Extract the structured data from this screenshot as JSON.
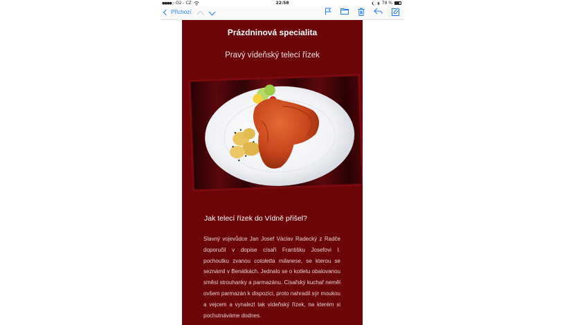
{
  "status_bar": {
    "carrier": "O2 - CZ",
    "time": "22:58",
    "battery": "79 %"
  },
  "toolbar": {
    "back_label": "Příchozí",
    "icons": [
      "chevron-up-icon",
      "chevron-down-icon",
      "flag-icon",
      "folder-icon",
      "trash-icon",
      "reply-icon",
      "compose-icon"
    ]
  },
  "email": {
    "title": "Prázdninová specialita",
    "subtitle": "Pravý vídeňský telecí řízek",
    "photo_alt": "plate with breaded schnitzel, potatoes and salad",
    "section_heading": "Jak telecí řízek do Vídně přišel?",
    "paragraph": {
      "part1": "Slavný vojevůdce Jan Josef Václav Radecký z Radče doporučil v dopise císaři Františku Josefovi I. pochoutku zvanou ",
      "italic": "cotoletta milanese",
      "part2": ", se kterou se seznámil v Benátkách. Jednalo se o kotletu obalovanou směsí strouhanky a parmazánu. Císařský kuchař neměl ovšem parmazán k dispozici, proto nahradil sýr moukou a vejcem a vynalezl tak vídeňský řízek, na kterém si pochutnáváme dodnes."
    }
  },
  "colors": {
    "background": "#6b0508",
    "accent": "#1a7cf5"
  }
}
